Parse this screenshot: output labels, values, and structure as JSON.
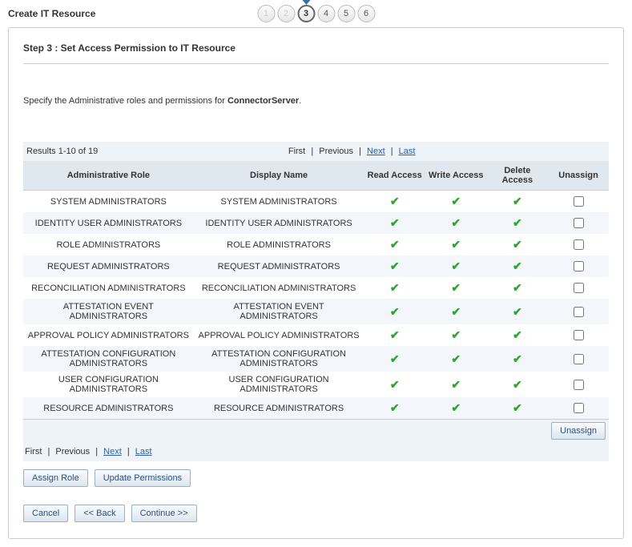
{
  "page_title": "Create IT Resource",
  "wizard": {
    "steps": [
      "1",
      "2",
      "3",
      "4",
      "5",
      "6"
    ],
    "current_index": 2
  },
  "step_heading": "Step 3 : Set Access Permission to IT Resource",
  "instruction_prefix": "Specify the Administrative roles and permissions for ",
  "instruction_bold": "ConnectorServer",
  "instruction_suffix": ".",
  "results_text": "Results 1-10 of 19",
  "pager": {
    "first": "First",
    "previous": "Previous",
    "next": "Next",
    "last": "Last"
  },
  "columns": {
    "role": "Administrative Role",
    "display": "Display Name",
    "read": "Read Access",
    "write": "Write Access",
    "delete": "Delete Access",
    "unassign": "Unassign"
  },
  "rows": [
    {
      "role": "SYSTEM ADMINISTRATORS",
      "display": "SYSTEM ADMINISTRATORS",
      "read": true,
      "write": true,
      "delete": true
    },
    {
      "role": "IDENTITY USER ADMINISTRATORS",
      "display": "IDENTITY USER ADMINISTRATORS",
      "read": true,
      "write": true,
      "delete": true
    },
    {
      "role": "ROLE ADMINISTRATORS",
      "display": "ROLE ADMINISTRATORS",
      "read": true,
      "write": true,
      "delete": true
    },
    {
      "role": "REQUEST ADMINISTRATORS",
      "display": "REQUEST ADMINISTRATORS",
      "read": true,
      "write": true,
      "delete": true
    },
    {
      "role": "RECONCILIATION ADMINISTRATORS",
      "display": "RECONCILIATION ADMINISTRATORS",
      "read": true,
      "write": true,
      "delete": true
    },
    {
      "role": "ATTESTATION EVENT ADMINISTRATORS",
      "display": "ATTESTATION EVENT ADMINISTRATORS",
      "read": true,
      "write": true,
      "delete": true
    },
    {
      "role": "APPROVAL POLICY ADMINISTRATORS",
      "display": "APPROVAL POLICY ADMINISTRATORS",
      "read": true,
      "write": true,
      "delete": true
    },
    {
      "role": "ATTESTATION CONFIGURATION ADMINISTRATORS",
      "display": "ATTESTATION CONFIGURATION ADMINISTRATORS",
      "read": true,
      "write": true,
      "delete": true
    },
    {
      "role": "USER CONFIGURATION ADMINISTRATORS",
      "display": "USER CONFIGURATION ADMINISTRATORS",
      "read": true,
      "write": true,
      "delete": true
    },
    {
      "role": "RESOURCE ADMINISTRATORS",
      "display": "RESOURCE ADMINISTRATORS",
      "read": true,
      "write": true,
      "delete": true
    }
  ],
  "buttons": {
    "unassign": "Unassign",
    "assign_role": "Assign Role",
    "update_permissions": "Update Permissions",
    "cancel": "Cancel",
    "back": "<< Back",
    "continue": "Continue >>"
  }
}
